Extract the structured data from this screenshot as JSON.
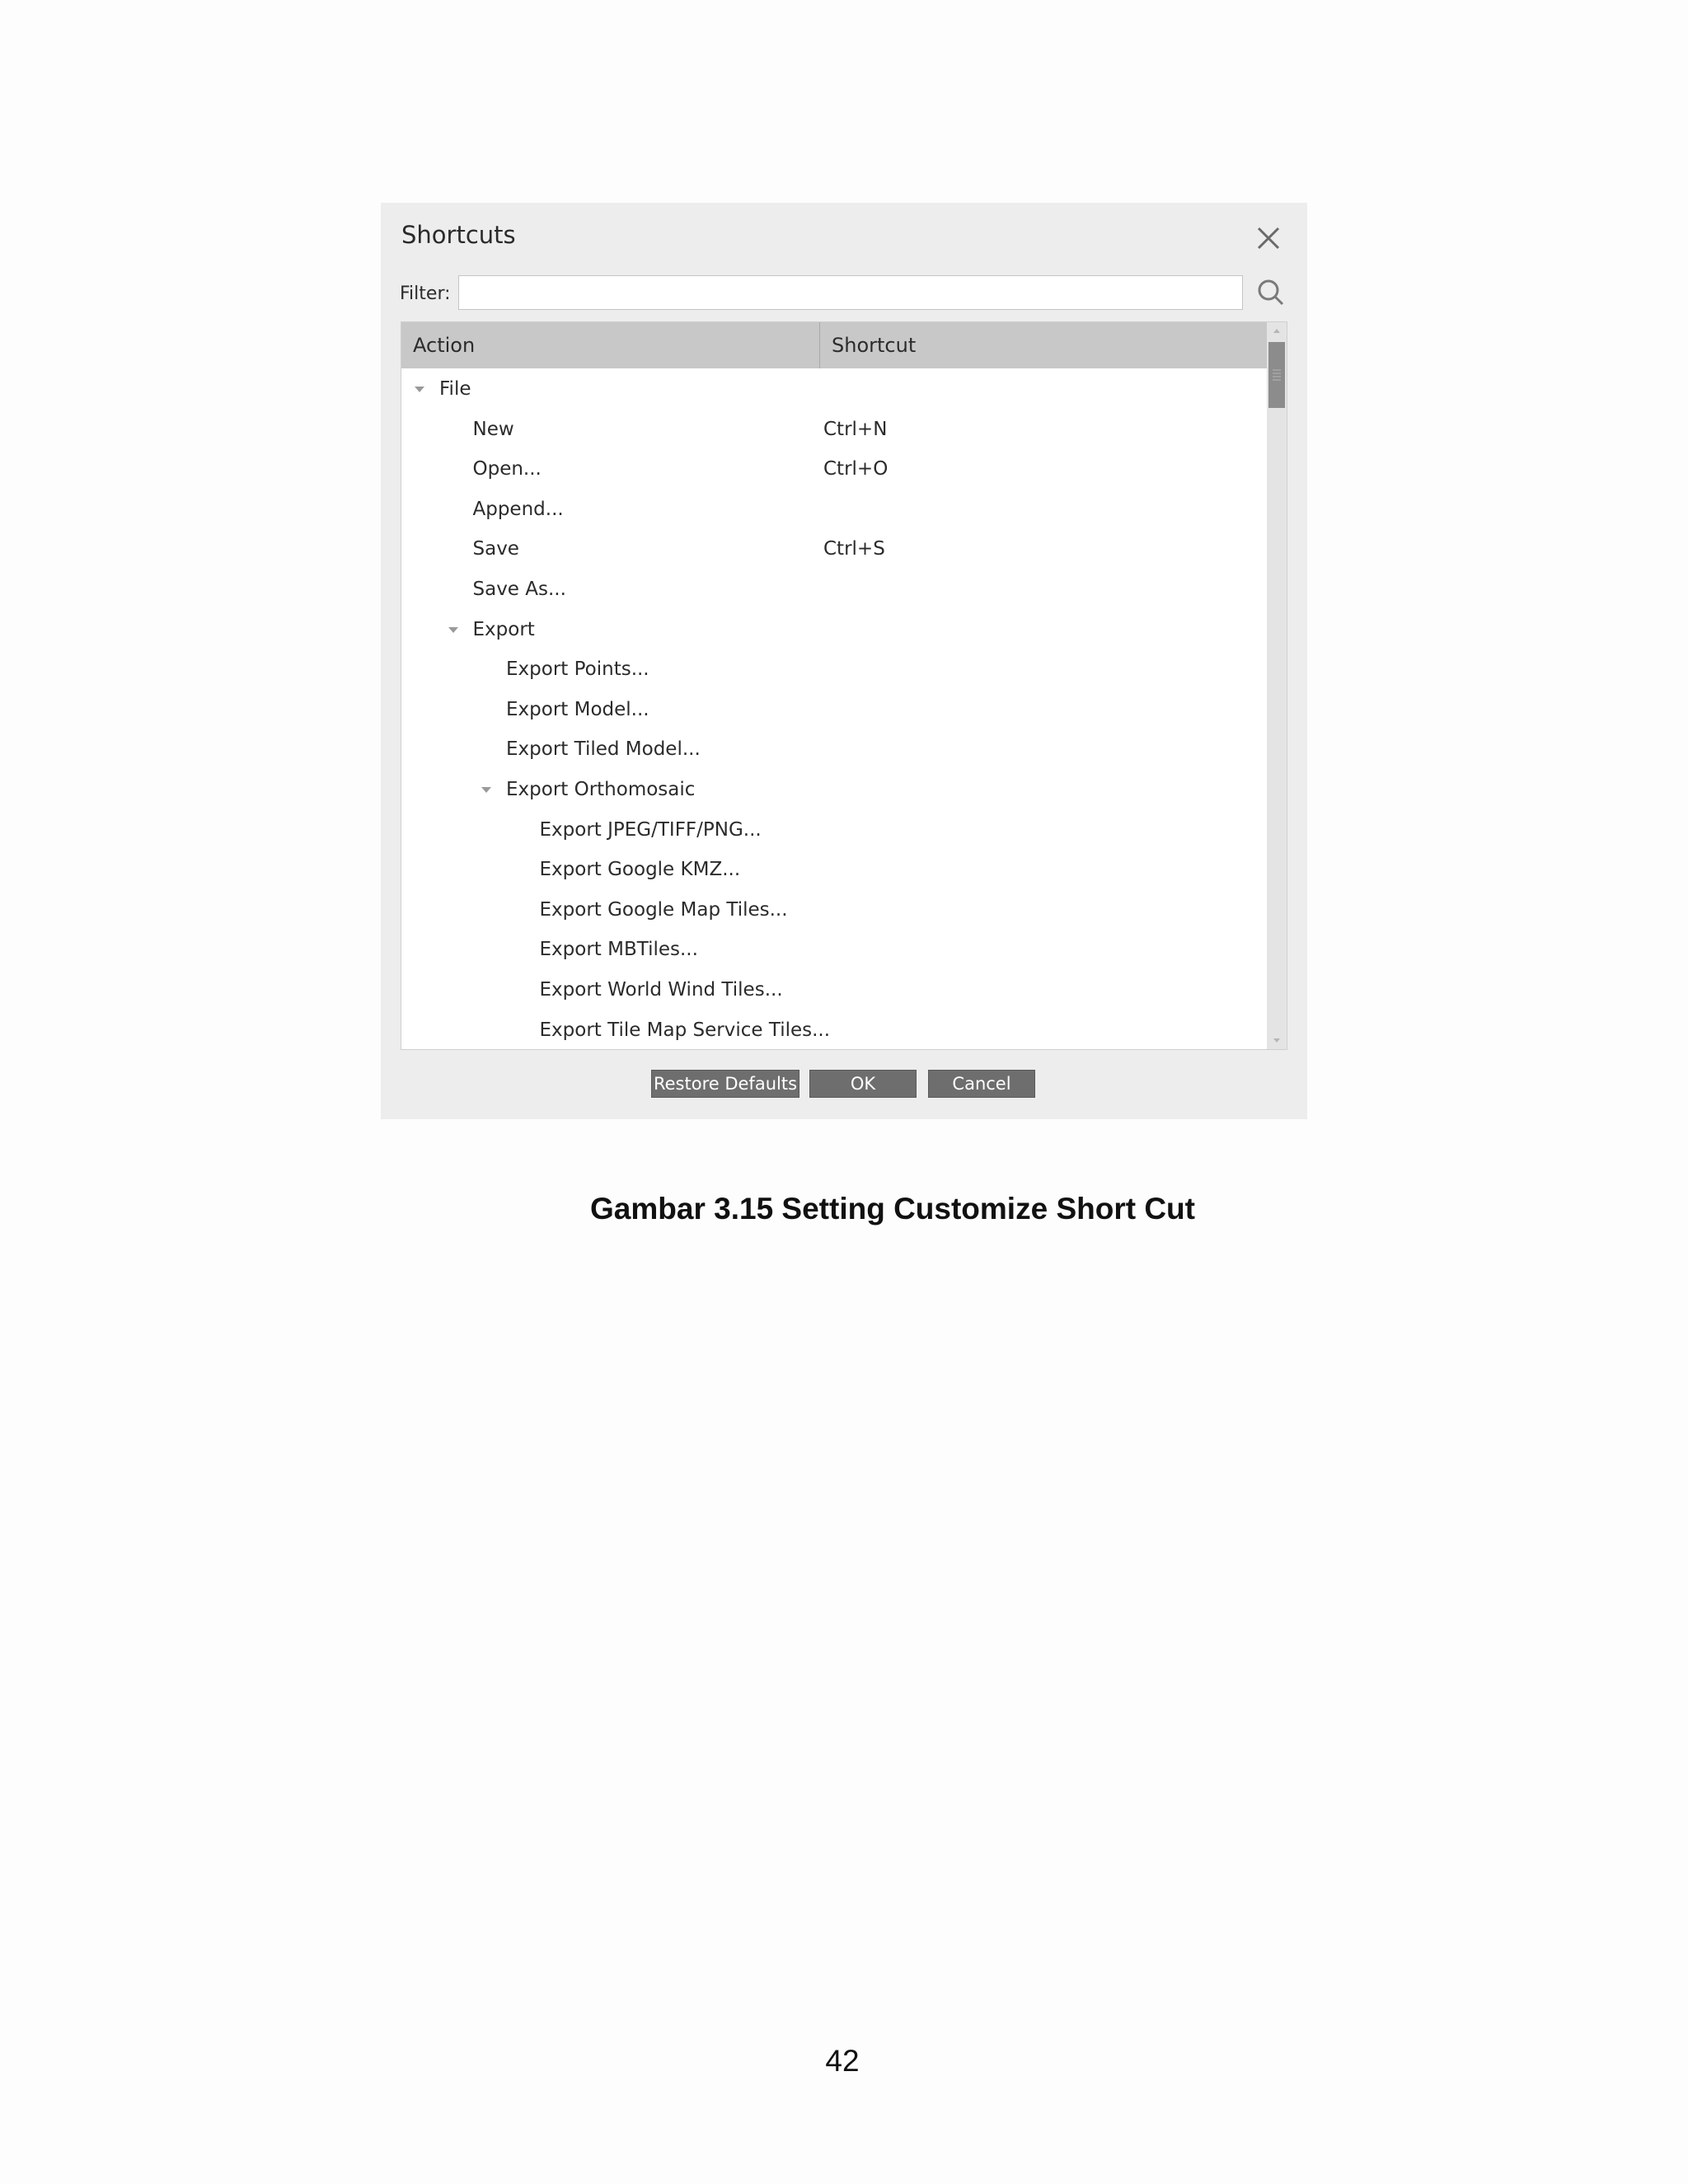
{
  "dialog": {
    "title": "Shortcuts",
    "filter_label": "Filter:",
    "filter_value": "",
    "columns": {
      "action": "Action",
      "shortcut": "Shortcut"
    },
    "rows": [
      {
        "label": "File",
        "shortcut": "",
        "level": 0,
        "expandable": true,
        "expanded": true
      },
      {
        "label": "New",
        "shortcut": "Ctrl+N",
        "level": 1,
        "expandable": false
      },
      {
        "label": "Open...",
        "shortcut": "Ctrl+O",
        "level": 1,
        "expandable": false
      },
      {
        "label": "Append...",
        "shortcut": "",
        "level": 1,
        "expandable": false
      },
      {
        "label": "Save",
        "shortcut": "Ctrl+S",
        "level": 1,
        "expandable": false
      },
      {
        "label": "Save As...",
        "shortcut": "",
        "level": 1,
        "expandable": false
      },
      {
        "label": "Export",
        "shortcut": "",
        "level": 1,
        "expandable": true,
        "expanded": true
      },
      {
        "label": "Export Points...",
        "shortcut": "",
        "level": 2,
        "expandable": false
      },
      {
        "label": "Export Model...",
        "shortcut": "",
        "level": 2,
        "expandable": false
      },
      {
        "label": "Export Tiled Model...",
        "shortcut": "",
        "level": 2,
        "expandable": false
      },
      {
        "label": "Export Orthomosaic",
        "shortcut": "",
        "level": 2,
        "expandable": true,
        "expanded": true
      },
      {
        "label": "Export JPEG/TIFF/PNG...",
        "shortcut": "",
        "level": 3,
        "expandable": false
      },
      {
        "label": "Export Google KMZ...",
        "shortcut": "",
        "level": 3,
        "expandable": false
      },
      {
        "label": "Export Google Map Tiles...",
        "shortcut": "",
        "level": 3,
        "expandable": false
      },
      {
        "label": "Export MBTiles...",
        "shortcut": "",
        "level": 3,
        "expandable": false
      },
      {
        "label": "Export World Wind Tiles...",
        "shortcut": "",
        "level": 3,
        "expandable": false
      },
      {
        "label": "Export Tile Map Service Tiles...",
        "shortcut": "",
        "level": 3,
        "expandable": false
      }
    ],
    "buttons": {
      "restore": "Restore Defaults",
      "ok": "OK",
      "cancel": "Cancel"
    },
    "icons": {
      "close": "close-icon",
      "search": "search-icon",
      "expander": "triangle-down-icon"
    },
    "colors": {
      "dialog_bg": "#ededed",
      "header_bg": "#c8c8c8",
      "button_bg": "#6e6e6e",
      "scroll_thumb": "#8c8c8c"
    }
  },
  "caption": "Gambar 3.15  Setting Customize Short Cut",
  "page_number": "42"
}
